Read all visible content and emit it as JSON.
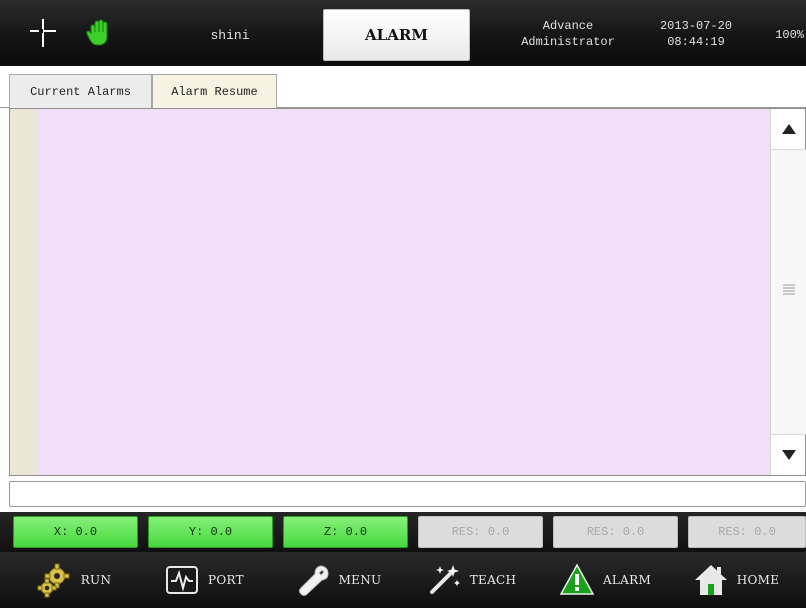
{
  "header": {
    "user_name": "shini",
    "screen_title": "ALARM",
    "access_level": "Advance",
    "role": "Administrator",
    "date": "2013-07-20",
    "time": "08:44:19",
    "zoom": "100%"
  },
  "tabs": [
    {
      "label": "Current Alarms"
    },
    {
      "label": "Alarm Resume",
      "selected": true
    }
  ],
  "alarm_list": {
    "background_color": "#f1dffa",
    "rows": []
  },
  "message": "",
  "coordinates": [
    {
      "label": "X: 0.0",
      "active": true
    },
    {
      "label": "Y: 0.0",
      "active": true
    },
    {
      "label": "Z: 0.0",
      "active": true
    },
    {
      "label": "RES: 0.0",
      "active": false
    },
    {
      "label": "RES: 0.0",
      "active": false
    },
    {
      "label": "RES: 0.0",
      "active": false
    }
  ],
  "nav": [
    {
      "label": "RUN",
      "icon": "gear-icon"
    },
    {
      "label": "PORT",
      "icon": "pulse-icon"
    },
    {
      "label": "MENU",
      "icon": "wrench-icon"
    },
    {
      "label": "TEACH",
      "icon": "magic-wand-icon"
    },
    {
      "label": "ALARM",
      "icon": "warning-icon"
    },
    {
      "label": "HOME",
      "icon": "home-icon"
    }
  ],
  "colors": {
    "active_coord": "#5fe052",
    "alarm_list_bg": "#f1dffa",
    "warning": "#1aa01a"
  }
}
